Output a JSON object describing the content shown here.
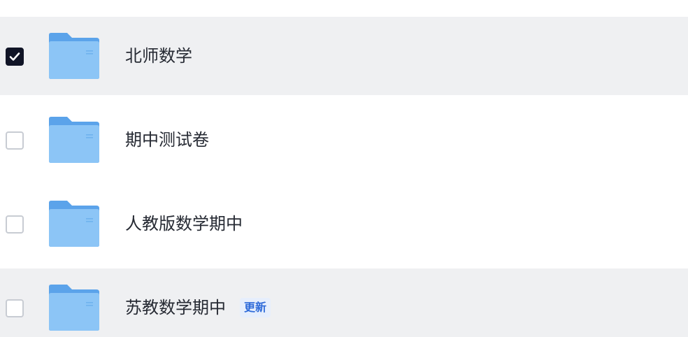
{
  "files": [
    {
      "name": "北师数学",
      "checked": true,
      "icon": "folder-icon"
    },
    {
      "name": "期中测试卷",
      "checked": false,
      "icon": "folder-icon"
    },
    {
      "name": "人教版数学期中",
      "checked": false,
      "icon": "folder-icon"
    },
    {
      "name": "苏教数学期中",
      "checked": false,
      "icon": "folder-icon",
      "badge": "更新"
    }
  ],
  "colors": {
    "row_selected_bg": "#eff0f2",
    "checkbox_checked": "#101426",
    "folder_blue": "#6aaef0",
    "badge_text": "#2f6bd9"
  }
}
